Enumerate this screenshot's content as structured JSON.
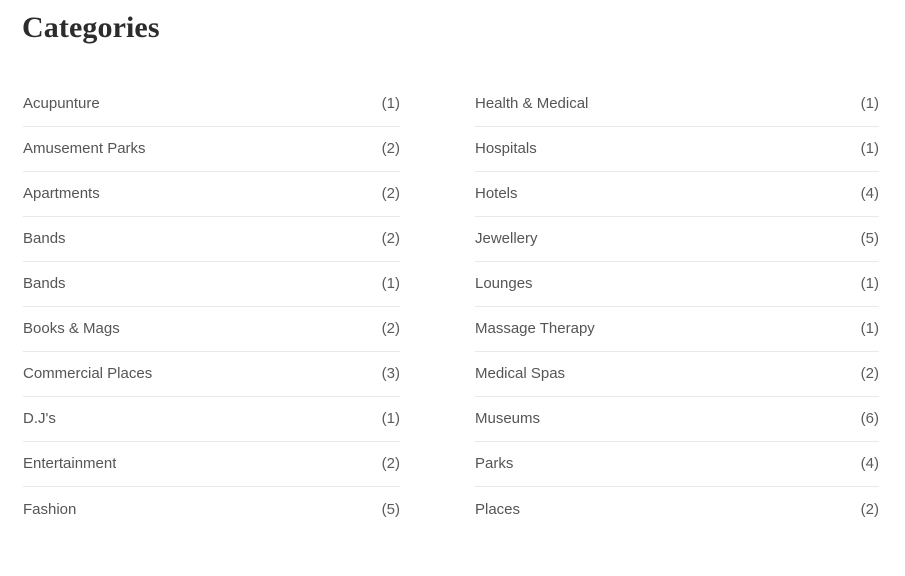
{
  "widget": {
    "title": "Categories",
    "colors": {
      "background": "#ffffff",
      "title_text": "#2c2c2c",
      "item_text": "#555555",
      "count_text": "#5a5a5a",
      "separator": "#e9e9e9"
    },
    "columns": [
      {
        "id": "left",
        "items": [
          {
            "label": "Acupunture",
            "count": "(1)"
          },
          {
            "label": "Amusement Parks",
            "count": "(2)"
          },
          {
            "label": "Apartments",
            "count": "(2)"
          },
          {
            "label": "Bands",
            "count": "(2)"
          },
          {
            "label": "Bands",
            "count": "(1)"
          },
          {
            "label": "Books & Mags",
            "count": "(2)"
          },
          {
            "label": "Commercial Places",
            "count": "(3)"
          },
          {
            "label": "D.J's",
            "count": "(1)"
          },
          {
            "label": "Entertainment",
            "count": "(2)"
          },
          {
            "label": "Fashion",
            "count": "(5)"
          }
        ]
      },
      {
        "id": "right",
        "items": [
          {
            "label": "Health & Medical",
            "count": "(1)"
          },
          {
            "label": "Hospitals",
            "count": "(1)"
          },
          {
            "label": "Hotels",
            "count": "(4)"
          },
          {
            "label": "Jewellery",
            "count": "(5)"
          },
          {
            "label": "Lounges",
            "count": "(1)"
          },
          {
            "label": "Massage Therapy",
            "count": "(1)"
          },
          {
            "label": "Medical Spas",
            "count": "(2)"
          },
          {
            "label": "Museums",
            "count": "(6)"
          },
          {
            "label": "Parks",
            "count": "(4)"
          },
          {
            "label": "Places",
            "count": "(2)"
          }
        ]
      }
    ]
  }
}
